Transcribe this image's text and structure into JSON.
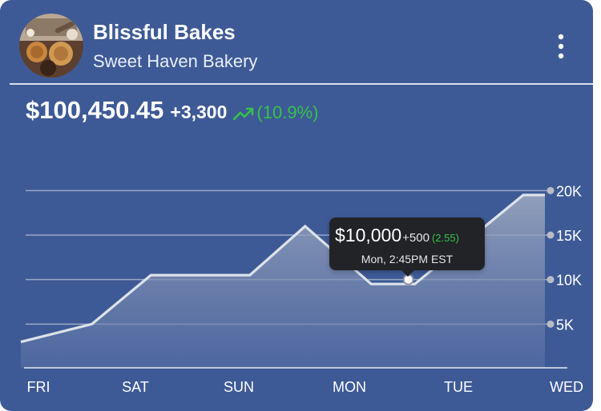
{
  "header": {
    "title": "Blissful Bakes",
    "subtitle": "Sweet Haven Bakery",
    "menu_icon": "kebab-menu-icon",
    "avatar_icon": "bakery-photo-avatar"
  },
  "summary": {
    "total": "$100,450.45",
    "change": "+3,300",
    "change_pct": "(10.9%)",
    "trend_icon": "trending-up-icon"
  },
  "tooltip": {
    "value": "$10,000",
    "delta": "+500",
    "pct": "(2.55)",
    "time": "Mon, 2:45PM EST"
  },
  "colors": {
    "card_background": "#3e5a96",
    "positive": "#35c24a",
    "tooltip_background": "#222327",
    "line": "#dde2ea"
  },
  "chart_data": {
    "type": "area",
    "title": "",
    "xlabel": "",
    "ylabel": "",
    "categories": [
      "FRI",
      "SAT",
      "SUN",
      "MON",
      "TUE",
      "WED"
    ],
    "y_ticks": [
      "20K",
      "15K",
      "10K",
      "5K"
    ],
    "y_tick_values": [
      20000,
      15000,
      10000,
      5000
    ],
    "ylim": [
      0,
      20000
    ],
    "grid": true,
    "legend": "none",
    "series": [
      {
        "x": [
          0,
          0.55,
          1.15,
          2.1,
          2.6,
          3.2,
          3.6,
          4.6,
          5.0
        ],
        "values": [
          3000,
          5000,
          10500,
          10500,
          16000,
          9500,
          9500,
          19500,
          19500
        ]
      }
    ],
    "highlight": {
      "x": 3.6,
      "value": 10000
    }
  }
}
